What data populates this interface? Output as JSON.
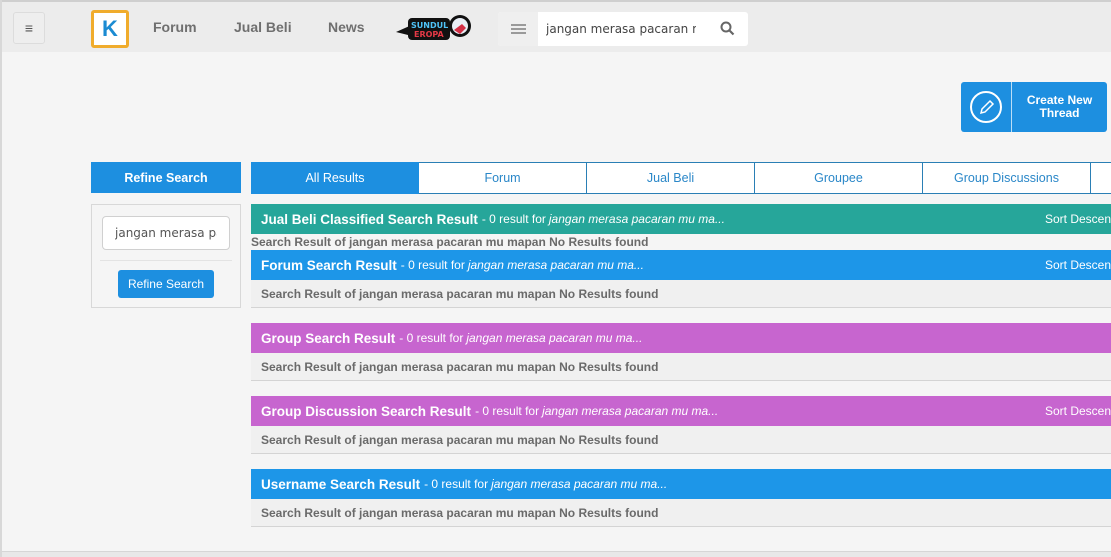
{
  "header": {
    "menu_icon": "hamburger-icon",
    "logo_letter": "K",
    "nav": [
      {
        "label": "Forum"
      },
      {
        "label": "Jual Beli"
      },
      {
        "label": "News"
      }
    ],
    "promo": {
      "line1": "SUNDUL",
      "line2": "EROPA"
    },
    "search": {
      "value": "jangan merasa pacaran mu",
      "category_icon": "list-icon",
      "search_icon": "search-icon"
    }
  },
  "create_thread": {
    "label_line1": "Create New",
    "label_line2": "Thread",
    "icon": "pencil-icon"
  },
  "sidebar": {
    "title": "Refine Search",
    "input_value": "jangan merasa pac",
    "button_label": "Refine Search"
  },
  "tabs": [
    {
      "label": "All Results",
      "active": true
    },
    {
      "label": "Forum"
    },
    {
      "label": "Jual Beli"
    },
    {
      "label": "Groupee"
    },
    {
      "label": "Group Discussions"
    },
    {
      "label": ""
    }
  ],
  "sections": [
    {
      "title": "Jual Beli Classified Search Result",
      "count": "- 0 result for",
      "query": "jangan merasa pacaran mu ma...",
      "sort": "Sort Descend",
      "body": "Search Result of jangan merasa pacaran mu mapan No Results found",
      "color": "#26a69a"
    },
    {
      "title": "Forum Search Result",
      "count": "- 0 result for",
      "query": "jangan merasa pacaran mu ma...",
      "sort": "Sort Descend",
      "body": "Search Result of jangan merasa pacaran mu mapan No Results found",
      "color": "#1d96e8"
    },
    {
      "title": "Group Search Result",
      "count": "- 0 result for",
      "query": "jangan merasa pacaran mu ma...",
      "body": "Search Result of jangan merasa pacaran mu mapan No Results found",
      "color": "#c765cf"
    },
    {
      "title": "Group Discussion Search Result",
      "count": "- 0 result for",
      "query": "jangan merasa pacaran mu ma...",
      "sort": "Sort Descend",
      "body": "Search Result of jangan merasa pacaran mu mapan No Results found",
      "color": "#c765cf"
    },
    {
      "title": "Username Search Result",
      "count": "- 0 result for",
      "query": "jangan merasa pacaran mu ma...",
      "body": "Search Result of jangan merasa pacaran mu mapan No Results found",
      "color": "#1d96e8"
    }
  ]
}
